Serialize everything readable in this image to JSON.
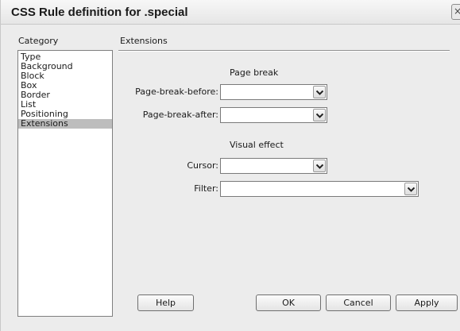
{
  "window": {
    "title": "CSS Rule definition for .special",
    "close_glyph": "×"
  },
  "category": {
    "header": "Category",
    "items": [
      "Type",
      "Background",
      "Block",
      "Box",
      "Border",
      "List",
      "Positioning",
      "Extensions"
    ],
    "selected": "Extensions"
  },
  "panel": {
    "header": "Extensions",
    "page_break": {
      "title": "Page break",
      "before_label": "Page-break-before:",
      "before_value": "",
      "after_label": "Page-break-after:",
      "after_value": ""
    },
    "visual_effect": {
      "title": "Visual effect",
      "cursor_label": "Cursor:",
      "cursor_value": "",
      "filter_label": "Filter:",
      "filter_value": ""
    }
  },
  "buttons": {
    "help": "Help",
    "ok": "OK",
    "cancel": "Cancel",
    "apply": "Apply"
  },
  "colors": {
    "dialog_bg": "#ececec",
    "selection": "#bdbdbd"
  }
}
